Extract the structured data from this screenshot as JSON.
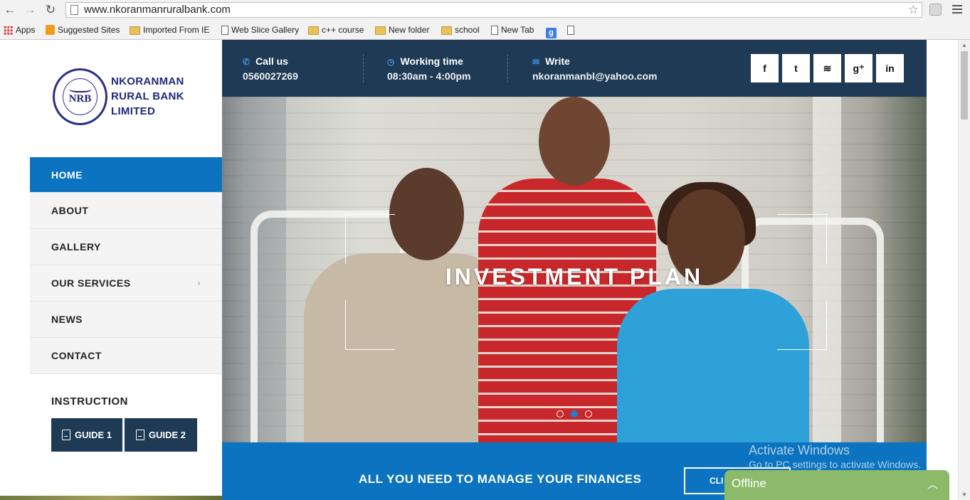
{
  "browser": {
    "url": "www.nkoranmanruralbank.com",
    "bookmarks": [
      {
        "label": "Apps",
        "icon": "apps-icon"
      },
      {
        "label": "Suggested Sites",
        "icon": "suggested-sites-icon"
      },
      {
        "label": "Imported From IE",
        "icon": "folder-icon"
      },
      {
        "label": "Web Slice Gallery",
        "icon": "page-icon"
      },
      {
        "label": "c++ course",
        "icon": "folder-icon"
      },
      {
        "label": "New folder",
        "icon": "folder-icon"
      },
      {
        "label": "school",
        "icon": "folder-icon"
      },
      {
        "label": "New Tab",
        "icon": "page-icon"
      },
      {
        "label": "",
        "icon": "google-icon"
      },
      {
        "label": "",
        "icon": "page-icon"
      }
    ]
  },
  "logo": {
    "line1": "NKORANMAN",
    "line2": "RURAL BANK",
    "line3": "LIMITED",
    "seal_text": "NRB"
  },
  "nav": {
    "items": [
      {
        "label": "HOME",
        "active": true
      },
      {
        "label": "ABOUT"
      },
      {
        "label": "GALLERY"
      },
      {
        "label": "OUR SERVICES",
        "submenu": true
      },
      {
        "label": "NEWS"
      },
      {
        "label": "CONTACT"
      }
    ],
    "submenu_glyph": "›"
  },
  "instruction": {
    "title": "INSTRUCTION",
    "guides": [
      "GUIDE 1",
      "GUIDE 2"
    ]
  },
  "topbar": {
    "call": {
      "title": "Call us",
      "value": "0560027269",
      "icon": "phone-icon"
    },
    "hours": {
      "title": "Working time",
      "value": "08:30am - 4:00pm",
      "icon": "clock-icon"
    },
    "write": {
      "title": "Write",
      "value": "nkoranmanbl@yahoo.com",
      "icon": "envelope-icon"
    },
    "social": [
      {
        "glyph": "f",
        "name": "facebook-icon"
      },
      {
        "glyph": "t",
        "name": "twitter-icon"
      },
      {
        "glyph": "≋",
        "name": "rss-icon"
      },
      {
        "glyph": "g⁺",
        "name": "google-plus-icon"
      },
      {
        "glyph": "in",
        "name": "linkedin-icon"
      }
    ]
  },
  "hero": {
    "title": "INVESTMENT PLAN",
    "slides": 3,
    "active_slide": 2
  },
  "cta": {
    "text": "ALL YOU NEED TO MANAGE YOUR FINANCES",
    "button_label": "CLI"
  },
  "windows": {
    "watermark_line1": "Activate Windows",
    "watermark_line2": "Go to PC settings to activate Windows."
  },
  "offline_bar": {
    "label": "Offline"
  },
  "colors": {
    "navy": "#1e3a55",
    "blue": "#0b73bf",
    "offline_green": "#8cb96a"
  }
}
